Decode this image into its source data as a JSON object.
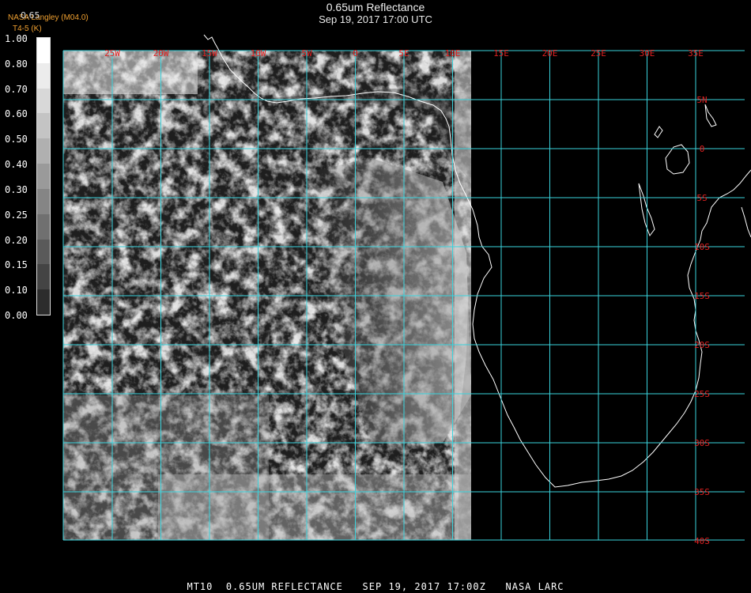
{
  "header": {
    "title": "0.65um Reflectance",
    "subtitle": "Sep 19, 2017 17:00 UTC"
  },
  "credits": {
    "line1": "NASA Langley (M04.0)",
    "line2": "T4-5 (K)"
  },
  "colorbar": {
    "label": "0.65",
    "ticks": [
      "1.00",
      "0.80",
      "0.70",
      "0.60",
      "0.50",
      "0.40",
      "0.30",
      "0.25",
      "0.20",
      "0.15",
      "0.10",
      "0.00"
    ],
    "colors": [
      "#ffffff",
      "#ececec",
      "#d8d8d8",
      "#c4c4c4",
      "#b0b0b0",
      "#9a9a9a",
      "#858585",
      "#707070",
      "#5a5a5a",
      "#444444",
      "#2c2c2c"
    ]
  },
  "map": {
    "grid_color": "#3ad3dd",
    "label_color": "#e02020",
    "longitude_labels": [
      "25W",
      "20W",
      "15W",
      "10W",
      "5W",
      "0",
      "5E",
      "10E",
      "15E",
      "20E",
      "25E",
      "30E",
      "35E"
    ],
    "latitude_labels": [
      "5N",
      "0",
      "5S",
      "10S",
      "15S",
      "20S",
      "25S",
      "30S",
      "35S",
      "40S"
    ],
    "coastline_color": "#ffffff"
  },
  "footer": {
    "text": "MT10  0.65UM REFLECTANCE   SEP 19, 2017 17:00Z   NASA LARC"
  }
}
